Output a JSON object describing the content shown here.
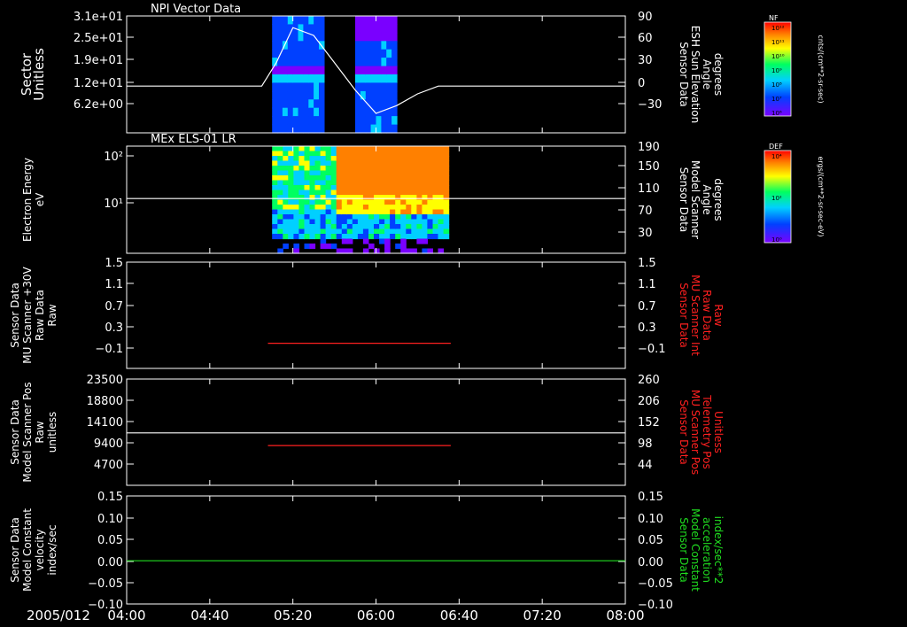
{
  "figure": {
    "date": "2005/012",
    "time_ticks": [
      "04:00",
      "04:40",
      "05:20",
      "06:00",
      "06:40",
      "07:20",
      "08:00"
    ],
    "time_range_hours": [
      4,
      8
    ]
  },
  "colorbars": [
    {
      "name": "nf-colorbar",
      "label": "NF",
      "unit": "cnts/(cm**2-sr-sec)",
      "ticks": [
        "10¹²",
        "10¹¹",
        "10¹⁰",
        "10⁹",
        "10⁸",
        "10⁷",
        "10⁶"
      ]
    },
    {
      "name": "def-colorbar",
      "label": "DEF",
      "unit": "ergs/(cm**2-sr-sec-eV)",
      "ticks": [
        "10⁴",
        "10²",
        "10⁰"
      ]
    }
  ],
  "chart_data": [
    {
      "type": "heatmap",
      "title": "NPI Vector Data",
      "ylabel_left": [
        "Sector",
        "Unitless"
      ],
      "ylabel_right": [
        "Sensor Data",
        "ESH Sun Elevation",
        "Angle",
        "degrees"
      ],
      "ylabel_right_color": "#ffffff",
      "left_ticks": [
        "3.1e+01",
        "2.5e+01",
        "1.9e+01",
        "1.2e+01",
        "6.2e+00"
      ],
      "right_ticks": [
        "90",
        "60",
        "30",
        "0",
        "−30"
      ],
      "right_range": [
        -60,
        90
      ],
      "spectrogram_blocks": [
        {
          "start": "05:10",
          "end": "05:35",
          "colormap": "nf"
        },
        {
          "start": "05:50",
          "end": "06:10",
          "colormap": "nf"
        }
      ],
      "series": [
        {
          "x": [
            "04:00",
            "05:05",
            "05:12",
            "05:20",
            "05:30",
            "05:40",
            "05:50",
            "06:00",
            "06:10",
            "06:20",
            "06:30",
            "06:40",
            "08:00"
          ],
          "y": [
            0,
            0,
            30,
            75,
            65,
            30,
            -5,
            -35,
            -25,
            -10,
            0,
            0,
            0
          ],
          "color": "#ffffff"
        }
      ]
    },
    {
      "type": "heatmap",
      "title": "MEx ELS-01 LR",
      "ylabel_left": [
        "Electron Energy",
        "eV"
      ],
      "ylabel_right": [
        "Sensor Data",
        "Model Scanner",
        "Angle",
        "degrees"
      ],
      "ylabel_right_color": "#ffffff",
      "left_ticks": [
        "10²",
        "10¹"
      ],
      "right_ticks": [
        "190",
        "150",
        "110",
        "70",
        "30"
      ],
      "right_range": [
        0,
        190
      ],
      "spectrogram_blocks": [
        {
          "start": "05:10",
          "end": "06:35",
          "colormap": "def"
        }
      ],
      "series": [
        {
          "x": [
            "04:00",
            "08:00"
          ],
          "y": [
            97,
            97
          ],
          "color": "#ffffff"
        }
      ]
    },
    {
      "type": "line",
      "title": "",
      "ylabel_left": [
        "Sensor Data",
        "MU Scanner +30V",
        "Raw Data",
        "Raw"
      ],
      "ylabel_right": [
        "Sensor Data",
        "MU Scanner Int",
        "Raw Data",
        "Raw"
      ],
      "ylabel_right_color": "#ff2020",
      "left_ticks": [
        "1.5",
        "1.1",
        "0.7",
        "0.3",
        "−0.1"
      ],
      "right_ticks": [
        "1.5",
        "1.1",
        "0.7",
        "0.3",
        "−0.1"
      ],
      "ylim": [
        -0.4,
        1.5
      ],
      "series": [
        {
          "x": [
            "05:08",
            "06:36"
          ],
          "y": [
            0.05,
            0.05
          ],
          "color": "#ff2020"
        }
      ]
    },
    {
      "type": "line",
      "title": "",
      "ylabel_left": [
        "Sensor Data",
        "Model Scanner Pos",
        "Raw",
        "unitless"
      ],
      "ylabel_right": [
        "Sensor Data",
        "MU Scanner Pos",
        "Telemetry Pos",
        "Unitless"
      ],
      "ylabel_right_color": "#ff2020",
      "left_ticks": [
        "23500",
        "18800",
        "14100",
        "9400",
        "4700"
      ],
      "right_ticks": [
        "260",
        "206",
        "152",
        "98",
        "44"
      ],
      "ylim": [
        0,
        23500
      ],
      "series": [
        {
          "x": [
            "04:00",
            "08:00"
          ],
          "y": [
            11600,
            11600
          ],
          "color": "#ffffff"
        },
        {
          "x": [
            "05:08",
            "06:36"
          ],
          "y": [
            8800,
            8800
          ],
          "color": "#ff2020"
        }
      ]
    },
    {
      "type": "line",
      "title": "",
      "ylabel_left": [
        "Sensor Data",
        "Model Constant",
        "velocity",
        "index/sec"
      ],
      "ylabel_right": [
        "Sensor Data",
        "Model Constant",
        "acceleration",
        "index/sec**2"
      ],
      "ylabel_right_color": "#20dd20",
      "left_ticks": [
        "0.15",
        "0.10",
        "0.05",
        "0.00",
        "−0.05",
        "−0.10"
      ],
      "right_ticks": [
        "0.15",
        "0.10",
        "0.05",
        "0.00",
        "−0.05",
        "−0.10"
      ],
      "ylim": [
        -0.1,
        0.15
      ],
      "series": [
        {
          "x": [
            "04:00",
            "08:00"
          ],
          "y": [
            0,
            0
          ],
          "color": "#20dd20"
        }
      ]
    }
  ]
}
